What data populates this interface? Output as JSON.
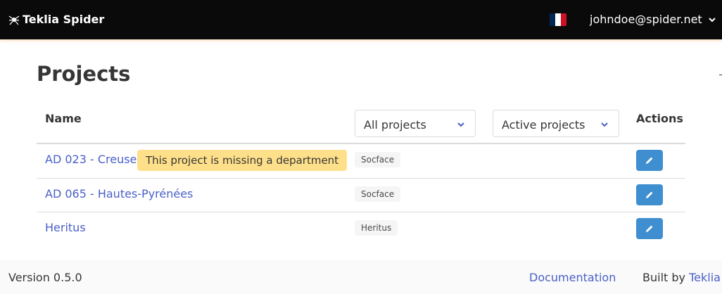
{
  "navbar": {
    "brand": "Teklia Spider",
    "user_email": "johndoe@spider.net",
    "flag_colors": [
      "#002654",
      "#ffffff",
      "#ce1126"
    ]
  },
  "page": {
    "title": "Projects"
  },
  "table": {
    "headers": {
      "name": "Name",
      "actions": "Actions"
    },
    "filters": {
      "scope": "All projects",
      "status": "Active projects"
    },
    "rows": [
      {
        "name": "AD 023 - Creuse",
        "warning": "This project is missing a department",
        "tag": "Socface"
      },
      {
        "name": "AD 065 - Hautes-Pyrénées",
        "warning": null,
        "tag": "Socface"
      },
      {
        "name": "Heritus",
        "warning": null,
        "tag": "Heritus"
      }
    ]
  },
  "footer": {
    "version": "Version 0.5.0",
    "documentation": "Documentation",
    "built_by": "Built by",
    "built_by_link": "Teklia"
  },
  "colors": {
    "link": "#485fc7",
    "button": "#3e8ed0",
    "warning": "#ffe08a",
    "navbar": "#0a0a0a"
  }
}
